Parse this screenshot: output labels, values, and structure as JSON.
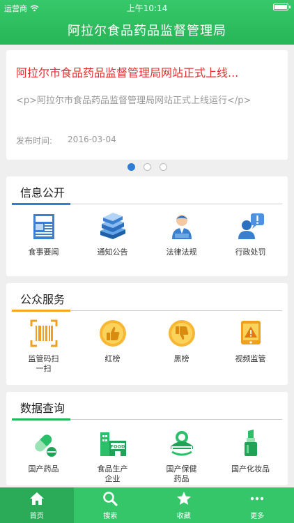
{
  "status": {
    "carrier": "运营商",
    "time": "上午10:14"
  },
  "header": {
    "title": "阿拉尔食品药品监督管理局"
  },
  "banner": {
    "title": "阿拉尔市食品药品监督管理局网站正式上线...",
    "body": "<p>阿拉尔市食品药品监督管理局网站正式上线运行</p>",
    "date_label": "发布时间:",
    "date": "2016-03-04"
  },
  "sections": {
    "info": {
      "title": "信息公开",
      "accent": "#2e7ed6",
      "items": [
        "食事要闻",
        "通知公告",
        "法律法规",
        "行政处罚"
      ]
    },
    "service": {
      "title": "公众服务",
      "accent": "#f5a623",
      "items": [
        "监管码扫一扫",
        "红榜",
        "黑榜",
        "视频监管"
      ]
    },
    "data": {
      "title": "数据查询",
      "accent": "#27b657",
      "items": [
        "国产药品",
        "食品生产企业",
        "国产保健药品",
        "国产化妆品"
      ]
    }
  },
  "tabs": [
    {
      "label": "首页",
      "icon": "home-icon"
    },
    {
      "label": "搜索",
      "icon": "search-icon"
    },
    {
      "label": "收藏",
      "icon": "star-icon"
    },
    {
      "label": "更多",
      "icon": "more-icon"
    }
  ],
  "colors": {
    "primary": "#35c66a",
    "headline": "#e32d2d",
    "page_dot": "#2e7ed6"
  }
}
